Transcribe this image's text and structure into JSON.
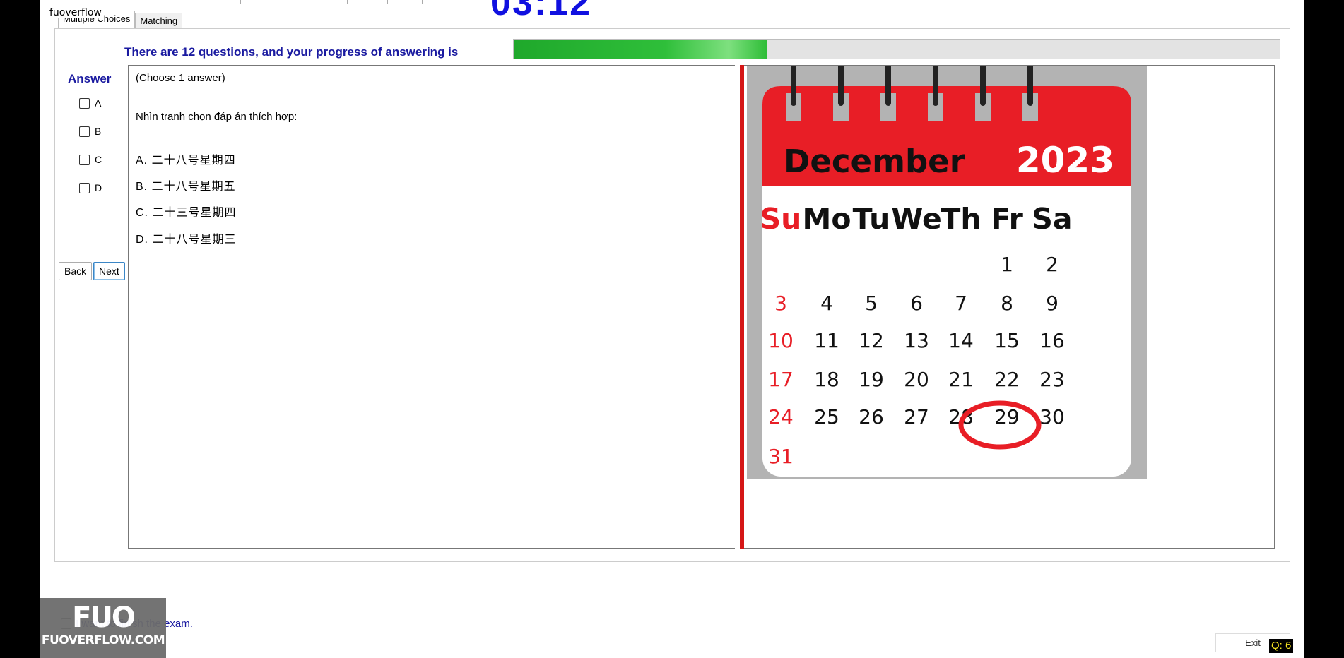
{
  "app": {
    "title": "fuoverflow"
  },
  "timer": "03:12",
  "tabs": [
    {
      "label": "Multiple Choices",
      "label_visible": "Multiple Choices"
    },
    {
      "label": "Matching"
    }
  ],
  "progress": {
    "label": "There are 12 questions, and your progress of answering is",
    "fraction": 0.33,
    "color": "#2fbf3a"
  },
  "answer": {
    "title": "Answer",
    "options": [
      "A",
      "B",
      "C",
      "D"
    ]
  },
  "nav": {
    "back": "Back",
    "next": "Next"
  },
  "question": {
    "choose": "(Choose 1 answer)",
    "prompt": "Nhìn tranh chọn đáp án thích hợp:",
    "options": [
      "A.  二十八号星期四",
      "B.  二十八号星期五",
      "C.  二十三号星期四",
      "D.  二十八号星期三"
    ]
  },
  "calendar": {
    "month": "December",
    "year": "2023",
    "weekdays": [
      "Su",
      "Mo",
      "Tu",
      "We",
      "Th",
      "Fr",
      "Sa"
    ],
    "weeks": [
      [
        "",
        "",
        "",
        "",
        "",
        "1",
        "2"
      ],
      [
        "3",
        "4",
        "5",
        "6",
        "7",
        "8",
        "9"
      ],
      [
        "10",
        "11",
        "12",
        "13",
        "14",
        "15",
        "16"
      ],
      [
        "17",
        "18",
        "19",
        "20",
        "21",
        "22",
        "23"
      ],
      [
        "24",
        "25",
        "26",
        "27",
        "28",
        "29",
        "30"
      ],
      [
        "31",
        "",
        "",
        "",
        "",
        "",
        ""
      ]
    ],
    "highlighted": "28",
    "accent": "#e81e26"
  },
  "finish": {
    "label": "I want to finish the exam."
  },
  "logo": {
    "big": "FUO",
    "site": "FUOVERFLOW.COM"
  },
  "footer": {
    "exit": "Exit",
    "qcount": "Q: 6"
  }
}
